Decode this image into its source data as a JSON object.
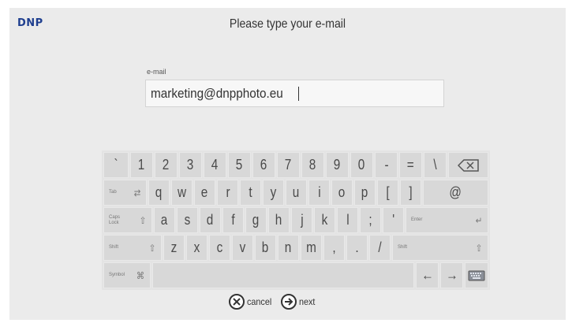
{
  "header": {
    "logo": "DNP",
    "title": "Please type your e-mail"
  },
  "form": {
    "label": "e-mail",
    "value": "marketing@dnpphoto.eu"
  },
  "keyboard": {
    "row1": [
      "`",
      "1",
      "2",
      "3",
      "4",
      "5",
      "6",
      "7",
      "8",
      "9",
      "0",
      "-",
      "=",
      "\\"
    ],
    "row2": [
      "q",
      "w",
      "e",
      "r",
      "t",
      "y",
      "u",
      "i",
      "o",
      "p",
      "[",
      "]",
      "@"
    ],
    "row3": [
      "a",
      "s",
      "d",
      "f",
      "g",
      "h",
      "j",
      "k",
      "l",
      ";",
      "'"
    ],
    "row4": [
      "z",
      "x",
      "c",
      "v",
      "b",
      "n",
      "m",
      ",",
      ".",
      "/"
    ],
    "tab_label": "Tab",
    "caps_label": "Caps Lock",
    "enter_label": "Enter",
    "shift_label": "Shift",
    "symbol_label": "Symbol",
    "left_arrow": "←",
    "right_arrow": "→"
  },
  "actions": {
    "cancel_label": "cancel",
    "next_label": "next"
  }
}
